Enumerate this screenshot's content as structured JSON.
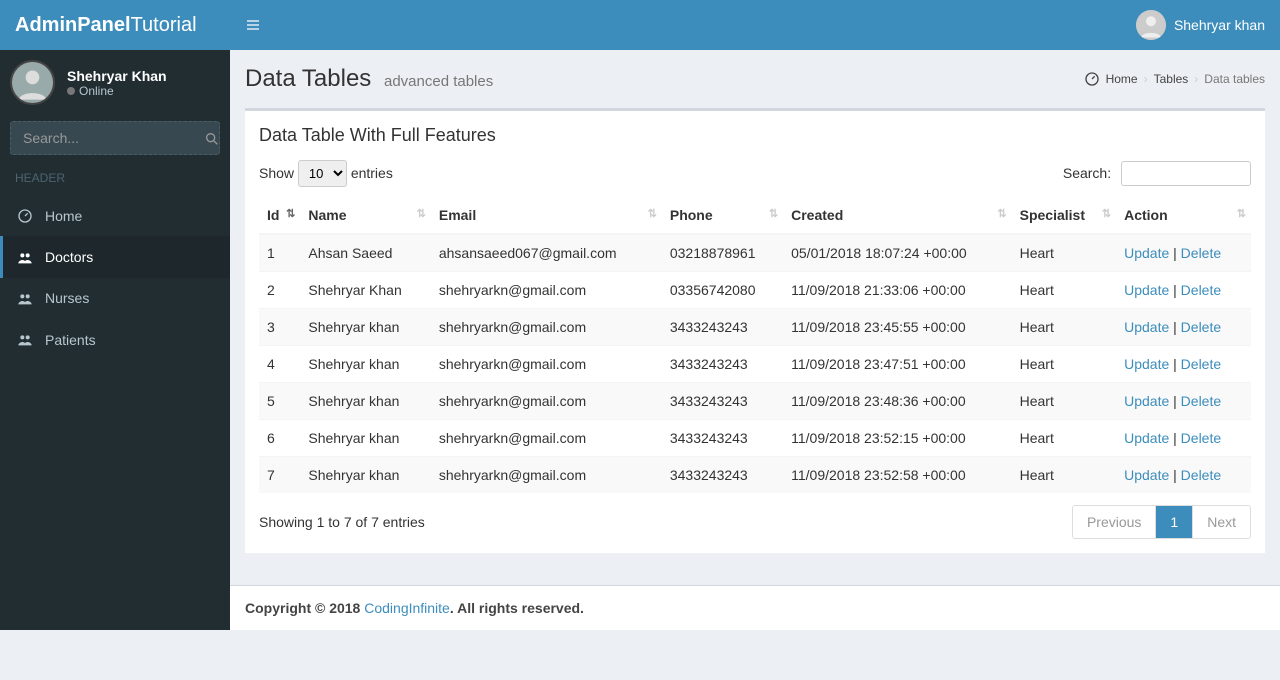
{
  "brand": {
    "bold": "AdminPanel",
    "light": "Tutorial"
  },
  "user": {
    "name": "Shehryar Khan",
    "topname": "Shehryar khan",
    "status": "Online"
  },
  "search": {
    "placeholder": "Search..."
  },
  "sidebarHeader": "HEADER",
  "menu": [
    {
      "label": "Home"
    },
    {
      "label": "Doctors"
    },
    {
      "label": "Nurses"
    },
    {
      "label": "Patients"
    }
  ],
  "page": {
    "title": "Data Tables",
    "subtitle": "advanced tables"
  },
  "breadcrumb": {
    "home": "Home",
    "tables": "Tables",
    "current": "Data tables"
  },
  "box": {
    "title": "Data Table With Full Features"
  },
  "dt": {
    "show": "Show",
    "entries": "entries",
    "entriesValue": "10",
    "searchLabel": "Search:",
    "info": "Showing 1 to 7 of 7 entries",
    "prev": "Previous",
    "next": "Next",
    "page1": "1"
  },
  "columns": [
    "Id",
    "Name",
    "Email",
    "Phone",
    "Created",
    "Specialist",
    "Action"
  ],
  "actions": {
    "update": "Update",
    "delete": "Delete",
    "sep": " | "
  },
  "rows": [
    {
      "id": "1",
      "name": "Ahsan Saeed",
      "email": "ahsansaeed067@gmail.com",
      "phone": "03218878961",
      "created": "05/01/2018 18:07:24 +00:00",
      "specialist": "Heart"
    },
    {
      "id": "2",
      "name": "Shehryar Khan",
      "email": "shehryarkn@gmail.com",
      "phone": "03356742080",
      "created": "11/09/2018 21:33:06 +00:00",
      "specialist": "Heart"
    },
    {
      "id": "3",
      "name": "Shehryar khan",
      "email": "shehryarkn@gmail.com",
      "phone": "3433243243",
      "created": "11/09/2018 23:45:55 +00:00",
      "specialist": "Heart"
    },
    {
      "id": "4",
      "name": "Shehryar khan",
      "email": "shehryarkn@gmail.com",
      "phone": "3433243243",
      "created": "11/09/2018 23:47:51 +00:00",
      "specialist": "Heart"
    },
    {
      "id": "5",
      "name": "Shehryar khan",
      "email": "shehryarkn@gmail.com",
      "phone": "3433243243",
      "created": "11/09/2018 23:48:36 +00:00",
      "specialist": "Heart"
    },
    {
      "id": "6",
      "name": "Shehryar khan",
      "email": "shehryarkn@gmail.com",
      "phone": "3433243243",
      "created": "11/09/2018 23:52:15 +00:00",
      "specialist": "Heart"
    },
    {
      "id": "7",
      "name": "Shehryar khan",
      "email": "shehryarkn@gmail.com",
      "phone": "3433243243",
      "created": "11/09/2018 23:52:58 +00:00",
      "specialist": "Heart"
    }
  ],
  "footer": {
    "copyright_prefix": "Copyright © 2018 ",
    "brand": "CodingInfinite",
    "suffix": ". All rights reserved."
  }
}
